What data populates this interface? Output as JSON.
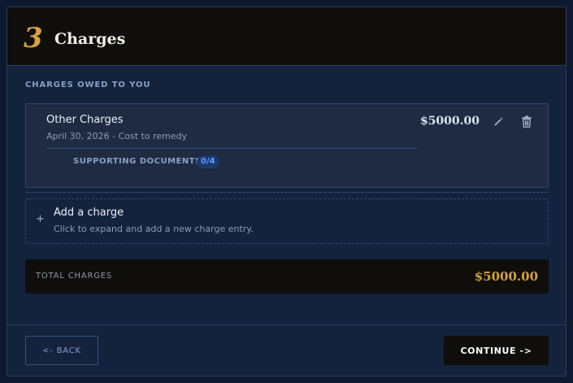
{
  "header": {
    "step_number": "3",
    "title": "Charges"
  },
  "section": {
    "label": "CHARGES OWED TO YOU"
  },
  "charges": [
    {
      "name": "Other Charges",
      "meta": "April 30, 2026 - Cost to remedy",
      "amount": "$5000.00",
      "documents_label": "SUPPORTING DOCUMENTS",
      "documents_count": "0/4"
    }
  ],
  "add_charge": {
    "plus": "+",
    "title": "Add a charge",
    "subtitle": "Click to expand and add a new charge entry."
  },
  "total": {
    "label": "TOTAL CHARGES",
    "amount": "$5000.00"
  },
  "footer": {
    "back_label": "<- BACK",
    "continue_label": "CONTINUE ->"
  },
  "icons": {
    "edit": "pencil-icon",
    "delete": "trash-icon"
  },
  "colors": {
    "accent_gold": "#d6a23e",
    "badge_blue": "#5f9bff",
    "panel_bg": "#13233e",
    "header_bg": "#0f0e0b"
  }
}
